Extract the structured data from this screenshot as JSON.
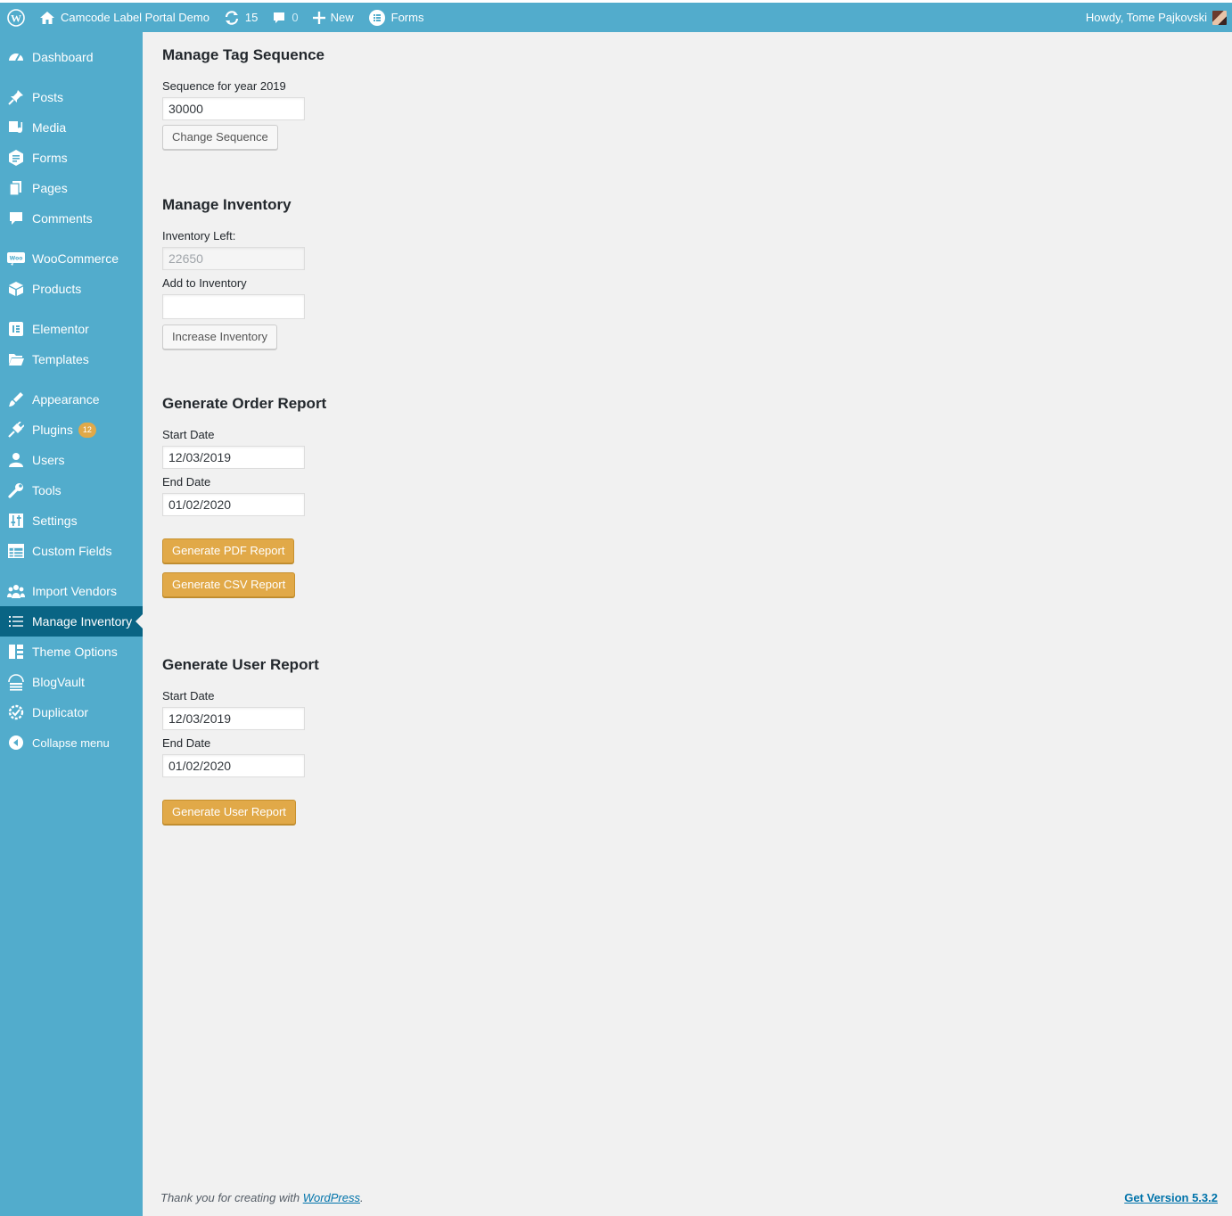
{
  "adminbar": {
    "site_name": "Camcode Label Portal Demo",
    "updates_count": "15",
    "comments_count": "0",
    "new_label": "New",
    "forms_label": "Forms",
    "howdy": "Howdy, Tome Pajkovski"
  },
  "sidebar": {
    "items": [
      {
        "label": "Dashboard",
        "icon": "dashboard-icon"
      },
      {
        "label": "Posts",
        "icon": "pin-icon"
      },
      {
        "label": "Media",
        "icon": "media-icon"
      },
      {
        "label": "Forms",
        "icon": "forms-icon"
      },
      {
        "label": "Pages",
        "icon": "pages-icon"
      },
      {
        "label": "Comments",
        "icon": "comment-icon"
      },
      {
        "label": "WooCommerce",
        "icon": "woocommerce-icon"
      },
      {
        "label": "Products",
        "icon": "box-icon"
      },
      {
        "label": "Elementor",
        "icon": "elementor-icon"
      },
      {
        "label": "Templates",
        "icon": "folder-icon"
      },
      {
        "label": "Appearance",
        "icon": "brush-icon"
      },
      {
        "label": "Plugins",
        "icon": "plugin-icon",
        "badge": "12"
      },
      {
        "label": "Users",
        "icon": "user-icon"
      },
      {
        "label": "Tools",
        "icon": "wrench-icon"
      },
      {
        "label": "Settings",
        "icon": "settings-icon"
      },
      {
        "label": "Custom Fields",
        "icon": "table-icon"
      },
      {
        "label": "Import Vendors",
        "icon": "groups-icon"
      },
      {
        "label": "Manage Inventory",
        "icon": "list-icon"
      },
      {
        "label": "Theme Options",
        "icon": "layout-icon"
      },
      {
        "label": "BlogVault",
        "icon": "blogvault-icon"
      },
      {
        "label": "Duplicator",
        "icon": "duplicator-icon"
      },
      {
        "label": "Collapse menu",
        "icon": "collapse-icon"
      }
    ]
  },
  "tag_sequence": {
    "title": "Manage Tag Sequence",
    "label": "Sequence for year 2019",
    "value": "30000",
    "button": "Change Sequence"
  },
  "inventory": {
    "title": "Manage Inventory",
    "left_label": "Inventory Left:",
    "left_value": "22650",
    "add_label": "Add to Inventory",
    "add_value": "",
    "button": "Increase Inventory"
  },
  "order_report": {
    "title": "Generate Order Report",
    "start_label": "Start Date",
    "start_value": "12/03/2019",
    "end_label": "End Date",
    "end_value": "01/02/2020",
    "pdf_button": "Generate PDF Report",
    "csv_button": "Generate CSV Report"
  },
  "user_report": {
    "title": "Generate User Report",
    "start_label": "Start Date",
    "start_value": "12/03/2019",
    "end_label": "End Date",
    "end_value": "01/02/2020",
    "button": "Generate User Report"
  },
  "footer": {
    "thanks_prefix": "Thank you for creating with ",
    "wp_link": "WordPress",
    "thanks_suffix": ".",
    "version": "Get Version 5.3.2"
  }
}
